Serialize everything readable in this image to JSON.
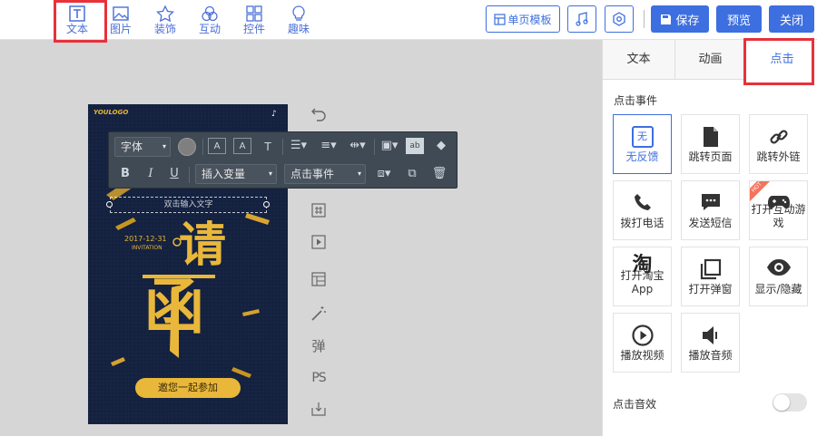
{
  "toolbar": {
    "tools": [
      {
        "icon": "text-icon",
        "label": "文本"
      },
      {
        "icon": "image-icon",
        "label": "图片"
      },
      {
        "icon": "star-icon",
        "label": "装饰"
      },
      {
        "icon": "interaction-icon",
        "label": "互动"
      },
      {
        "icon": "widget-grid-icon",
        "label": "控件"
      },
      {
        "icon": "bulb-icon",
        "label": "趣味"
      }
    ],
    "single_page_template": "单页模板",
    "save": "保存",
    "preview": "预览",
    "close": "关闭"
  },
  "panel": {
    "tabs": [
      "文本",
      "动画",
      "点击"
    ],
    "active_tab": "点击",
    "section_title": "点击事件",
    "events": [
      {
        "icon": "no-feedback-icon",
        "icon_text": "无",
        "label": "无反馈",
        "selected": true
      },
      {
        "icon": "page-icon",
        "label": "跳转页面"
      },
      {
        "icon": "link-icon",
        "label": "跳转外链"
      },
      {
        "icon": "phone-icon",
        "label": "拨打电话"
      },
      {
        "icon": "sms-icon",
        "label": "发送短信"
      },
      {
        "icon": "gamepad-icon",
        "label": "打开互动游戏",
        "badge": "HOT"
      },
      {
        "icon": "taobao-icon",
        "icon_text": "淘",
        "label": "打开淘宝App"
      },
      {
        "icon": "popup-window-icon",
        "label": "打开弹窗"
      },
      {
        "icon": "eye-icon",
        "label": "显示/隐藏"
      },
      {
        "icon": "play-video-icon",
        "label": "播放视频"
      },
      {
        "icon": "speaker-icon",
        "label": "播放音频"
      }
    ],
    "sound_label": "点击音效",
    "sound_enabled": false
  },
  "canvas": {
    "poster": {
      "logo": "YOULOGO",
      "date": "2017-12-31",
      "invitation_en": "INVITATION",
      "big_char_1": "请",
      "big_char_2": "函",
      "cta": "邀您一起参加",
      "selected_text_placeholder": "双击输入文字"
    },
    "side_tools": [
      "undo-icon",
      "hash-icon",
      "play-icon",
      "layout-icon",
      "magic-wand-icon",
      "popup-icon",
      "ps-icon",
      "download-icon"
    ],
    "side_text": {
      "popup": "弹",
      "ps": "PS"
    },
    "text_toolbar": {
      "font": "字体",
      "bold": "B",
      "italic": "I",
      "underline": "U",
      "insert_variable": "插入变量",
      "click_event": "点击事件",
      "ab": "ab"
    }
  },
  "colors": {
    "accent": "#3d6fe0",
    "highlight": "#e8313a",
    "poster_bg": "#14213f",
    "gold": "#e9b73a",
    "toolbar_bg": "#3f4a55"
  }
}
